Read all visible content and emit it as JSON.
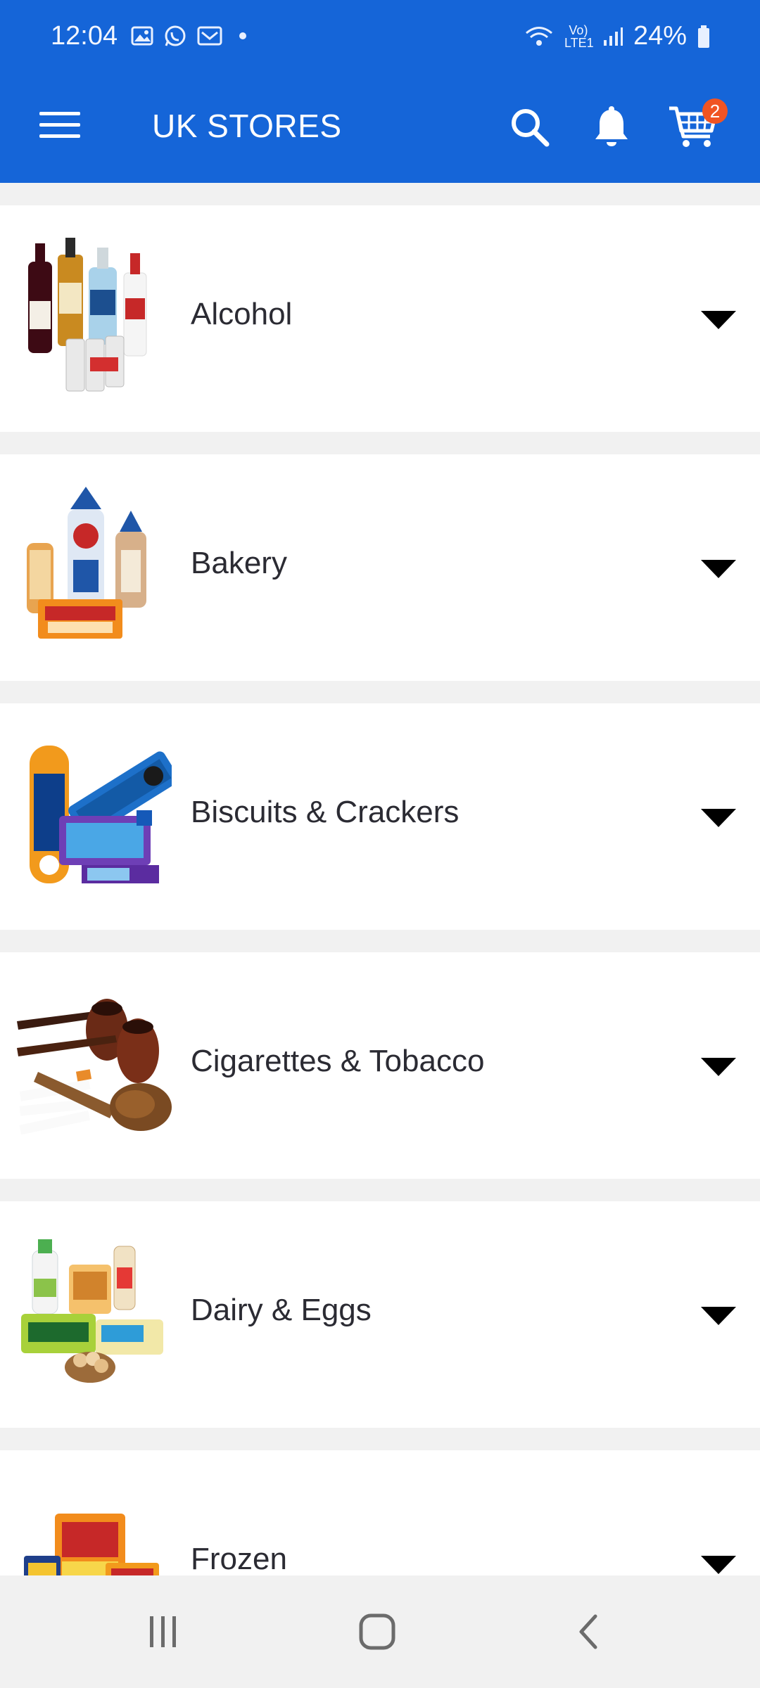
{
  "status_bar": {
    "time": "12:04",
    "battery": "24%",
    "network": "Vo) LTE1",
    "icons": [
      "gallery-icon",
      "whatsapp-icon",
      "email-icon",
      "dot-icon",
      "wifi-icon",
      "signal-icon",
      "battery-icon"
    ]
  },
  "app_bar": {
    "title": "UK STORES",
    "cart_count": "2",
    "icons": [
      "menu-icon",
      "search-icon",
      "bell-icon",
      "cart-icon"
    ]
  },
  "categories": [
    {
      "label": "Alcohol",
      "image": "alcohol-bottles-image"
    },
    {
      "label": "Bakery",
      "image": "bakery-bread-image"
    },
    {
      "label": "Biscuits & Crackers",
      "image": "biscuits-packs-image"
    },
    {
      "label": "Cigarettes & Tobacco",
      "image": "pipes-tobacco-image"
    },
    {
      "label": "Dairy & Eggs",
      "image": "dairy-eggs-image"
    },
    {
      "label": "Frozen",
      "image": "frozen-foods-image"
    }
  ],
  "nav_bar": {
    "icons": [
      "recent-apps-icon",
      "home-icon",
      "back-icon"
    ]
  },
  "colors": {
    "app_bar": "#1565d8",
    "badge": "#f05423",
    "row_bg": "#ffffff",
    "page_bg": "#f1f1f1",
    "label_text": "#2b2b33"
  }
}
